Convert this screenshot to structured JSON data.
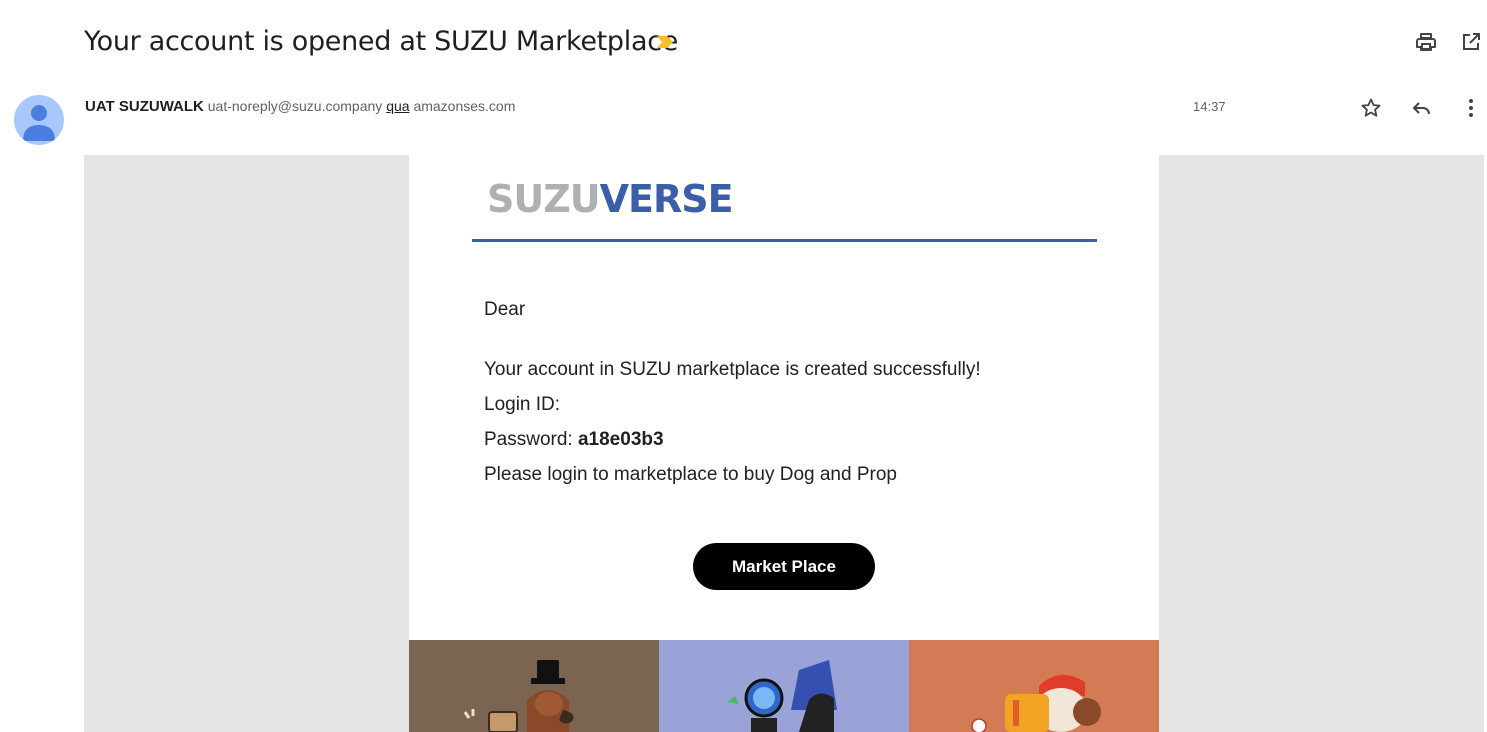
{
  "email": {
    "subject": "Your account is opened at SUZU Marketplace",
    "sender_name": "UAT SUZUWALK",
    "sender_email": "uat-noreply@suzu.company",
    "via_label": "qua",
    "via_domain": "amazonses.com",
    "time": "14:37"
  },
  "icons": {
    "importance": "importance-marker-icon",
    "print": "print-icon",
    "popout": "open-in-new-window-icon",
    "star": "star-icon",
    "reply": "reply-icon",
    "more": "more-vertical-icon",
    "avatar": "default-avatar-icon"
  },
  "body": {
    "logo_gray": "SUZU",
    "logo_blue": "VERSE",
    "greeting": "Dear",
    "line_created": "Your account in SUZU marketplace is created successfully!",
    "login_label": "Login ID:",
    "password_label": "Password:",
    "password_value": "a18e03b3",
    "line_login": "Please login to marketplace to buy Dog and Prop",
    "button_label": "Market Place"
  },
  "colors": {
    "importance": "#f6c026",
    "logo_gray": "#aeb0b3",
    "logo_blue": "#3b5ea8",
    "rule": "#3b5ea8",
    "button_bg": "#000000",
    "tile_1": "#7b6551",
    "tile_2": "#9aa3d8",
    "tile_3": "#d27b55"
  }
}
